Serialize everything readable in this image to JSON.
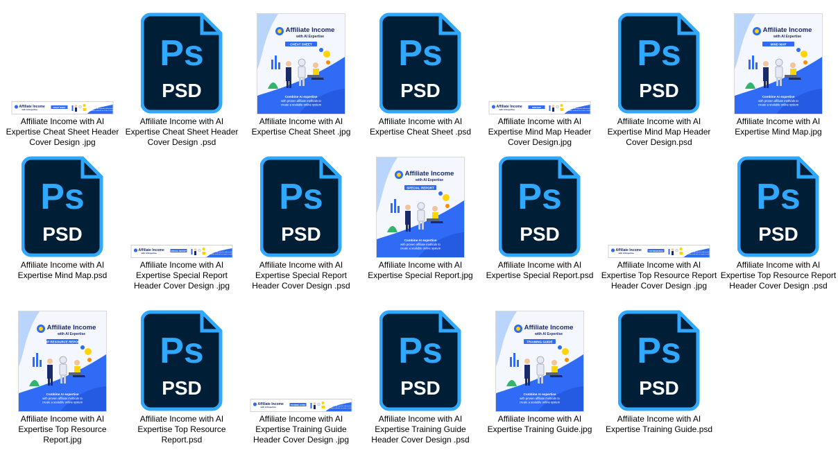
{
  "colors": {
    "psd_fill": "#001e36",
    "psd_border": "#31a8ff",
    "psd_text": "#31a8ff",
    "psd_subtext": "#ffffff",
    "cover_blue": "#2f6bf5",
    "cover_light_blue": "#b9d5fb",
    "label_text": "#000000"
  },
  "icon_text": {
    "ps": "Ps",
    "psd": "PSD"
  },
  "cover_text": {
    "brand_line1": "Affiliate Income",
    "brand_line2": "with AI Expertise",
    "footer_line1": "Combine AI expertise",
    "footer_line2": "with proven affiliate methods to",
    "footer_line3": "create a scalable online system",
    "banner_right1": "Combine AI expertise with proven",
    "banner_right2": "affiliate methods to create a scalable system"
  },
  "files": [
    {
      "type": "banner",
      "badge": "CHEAT SHEET",
      "label": "Affiliate Income with AI Expertise Cheat Sheet Header Cover Design .jpg"
    },
    {
      "type": "psd",
      "badge": "",
      "label": "Affiliate Income with AI Expertise Cheat Sheet Header Cover Design .psd"
    },
    {
      "type": "cover",
      "badge": "CHEAT SHEET",
      "label": "Affiliate Income with AI Expertise Cheat Sheet .jpg"
    },
    {
      "type": "psd",
      "badge": "",
      "label": "Affiliate Income with AI Expertise Cheat Sheet .psd"
    },
    {
      "type": "banner",
      "badge": "MIND MAP",
      "label": "Affiliate Income with AI Expertise Mind Map Header Cover Design.jpg"
    },
    {
      "type": "psd",
      "badge": "",
      "label": "Affiliate Income with AI Expertise Mind Map Header Cover Design.psd"
    },
    {
      "type": "cover",
      "badge": "MIND MAP",
      "label": "Affiliate Income with AI Expertise Mind Map.jpg"
    },
    {
      "type": "psd",
      "badge": "",
      "label": "Affiliate Income with AI Expertise Mind Map.psd"
    },
    {
      "type": "banner",
      "badge": "SPECIAL REPORT",
      "label": "Affiliate Income with AI Expertise Special Report Header Cover Design .jpg"
    },
    {
      "type": "psd",
      "badge": "",
      "label": "Affiliate Income with AI Expertise Special Report Header Cover Design .psd"
    },
    {
      "type": "cover",
      "badge": "SPECIAL REPORT",
      "label": "Affiliate Income with AI Expertise Special Report.jpg"
    },
    {
      "type": "psd",
      "badge": "",
      "label": "Affiliate Income with AI Expertise Special Report.psd"
    },
    {
      "type": "banner",
      "badge": "TOP RESOURCE",
      "label": "Affiliate Income with AI Expertise Top Resource Report Header Cover Design .jpg"
    },
    {
      "type": "psd",
      "badge": "",
      "label": "Affiliate Income with AI Expertise Top Resource Report Header Cover Design .psd"
    },
    {
      "type": "cover",
      "badge": "TOP RESOURCE REPORT",
      "label": "Affiliate Income with AI Expertise Top Resource Report.jpg"
    },
    {
      "type": "psd",
      "badge": "",
      "label": "Affiliate Income with AI Expertise Top Resource Report.psd"
    },
    {
      "type": "banner",
      "badge": "TRAINING GUIDE",
      "label": "Affiliate Income with AI Expertise Training Guide Header Cover Design .jpg"
    },
    {
      "type": "psd",
      "badge": "",
      "label": "Affiliate Income with AI Expertise Training Guide Header Cover Design .psd"
    },
    {
      "type": "cover",
      "badge": "TRAINING GUIDE",
      "label": "Affiliate Income with AI Expertise Training Guide.jpg"
    },
    {
      "type": "psd",
      "badge": "",
      "label": "Affiliate Income with AI Expertise Training Guide.psd"
    }
  ]
}
